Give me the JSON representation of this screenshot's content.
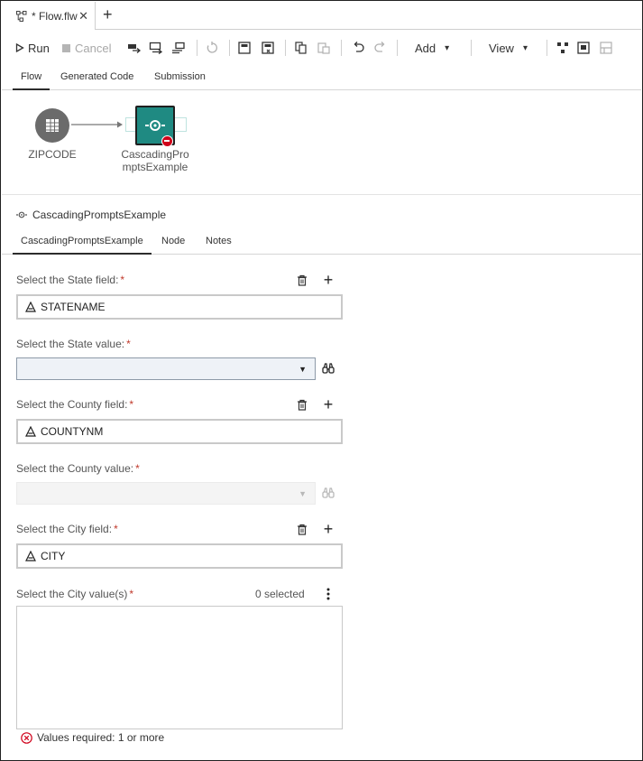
{
  "document_tab": {
    "title": "* Flow.flw",
    "close_glyph": "✕",
    "add_glyph": "+"
  },
  "toolbar": {
    "run_label": "Run",
    "cancel_label": "Cancel",
    "add_label": "Add",
    "view_label": "View",
    "caret": "▾"
  },
  "view_tabs": [
    "Flow",
    "Generated Code",
    "Submission"
  ],
  "canvas": {
    "source_node": {
      "label": "ZIPCODE"
    },
    "target_node": {
      "label_line1": "CascadingPro",
      "label_line2": "mptsExample"
    }
  },
  "properties": {
    "title": "CascadingPromptsExample",
    "tabs": [
      "CascadingPromptsExample",
      "Node",
      "Notes"
    ]
  },
  "form": {
    "required_mark": "*",
    "state_field_label": "Select the State field:",
    "state_field_value": "STATENAME",
    "state_value_label": "Select the State value:",
    "county_field_label": "Select the County field:",
    "county_field_value": "COUNTYNM",
    "county_value_label": "Select the County value:",
    "city_field_label": "Select the City field:",
    "city_field_value": "CITY",
    "city_values_label": "Select the City value(s)",
    "selected_count": "0 selected",
    "error_message": "Values required: 1 or more"
  },
  "colors": {
    "node_source": "#6b6b6b",
    "node_target": "#1f8a82",
    "error": "#d0021b",
    "required": "#c0392b"
  },
  "icons": {
    "flow": "flow-icon",
    "column": "character-column-icon",
    "delete": "trash-icon",
    "browse": "binoculars-icon",
    "error": "error-circle-icon"
  }
}
